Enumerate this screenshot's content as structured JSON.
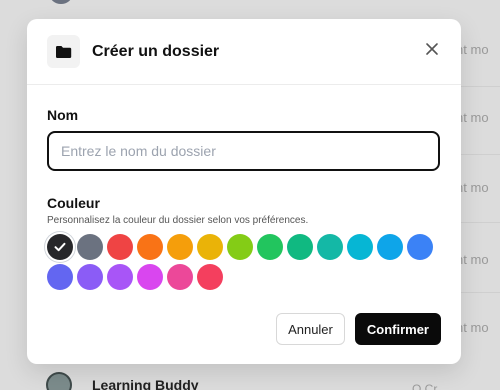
{
  "background": {
    "row_text": "ment mo",
    "bottom_item_title": "Learning Buddy",
    "bottom_item_right": "Q  Cr"
  },
  "dialog": {
    "title": "Créer un dossier",
    "icon": "folder-icon",
    "close_icon": "close-icon",
    "name": {
      "label": "Nom",
      "placeholder": "Entrez le nom du dossier",
      "value": ""
    },
    "color": {
      "label": "Couleur",
      "help": "Personnalisez la couleur du dossier selon vos préférences.",
      "selected": "#27272a",
      "options": [
        "#27272a",
        "#6b7280",
        "#ef4444",
        "#f97316",
        "#f59e0b",
        "#eab308",
        "#84cc16",
        "#22c55e",
        "#10b981",
        "#14b8a6",
        "#06b6d4",
        "#0ea5e9",
        "#3b82f6",
        "#6366f1",
        "#8b5cf6",
        "#a855f7",
        "#d946ef",
        "#ec4899",
        "#f43f5e"
      ]
    },
    "buttons": {
      "cancel": "Annuler",
      "confirm": "Confirmer"
    }
  }
}
